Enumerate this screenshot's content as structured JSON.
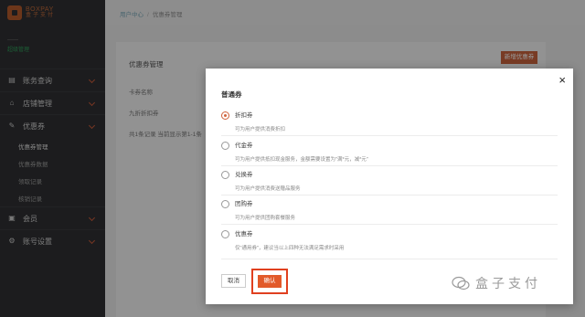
{
  "brand": {
    "en": "BOXPAY",
    "cn": "盒子支付"
  },
  "user": {
    "line1": "——",
    "role": "超级管理"
  },
  "sidebar": {
    "items": [
      {
        "label": "账务查询",
        "icon": "ledger-icon"
      },
      {
        "label": "店铺管理",
        "icon": "store-icon"
      },
      {
        "label": "优惠券",
        "icon": "coupon-icon"
      }
    ],
    "sub_items": [
      {
        "label": "优惠券管理"
      },
      {
        "label": "优惠券数据"
      },
      {
        "label": "领取记录"
      },
      {
        "label": "核销记录"
      }
    ],
    "items_after": [
      {
        "label": "会员",
        "icon": "member-icon"
      },
      {
        "label": "账号设置",
        "icon": "account-icon"
      }
    ]
  },
  "breadcrumb": {
    "home": "用户中心",
    "separator": "/",
    "current": "优惠券管理"
  },
  "panel": {
    "title": "优惠券管理",
    "new_button": "新增优惠券",
    "label1": "卡券名称",
    "label2": "九折折扣券",
    "label3": "共1条记录  当前显示第1-1条"
  },
  "modal": {
    "close": "×",
    "title": "普通券",
    "options": [
      {
        "label": "折扣券",
        "desc": "可为用户提供消费折扣",
        "checked": true
      },
      {
        "label": "代金券",
        "desc": "可为用户提供抵扣现金服务，金额需要设置为\"满*元，减*元\""
      },
      {
        "label": "兑换券",
        "desc": "可为用户提供消费送赠品服务"
      },
      {
        "label": "团购券",
        "desc": "可为用户提供团购套餐服务"
      },
      {
        "label": "优惠券",
        "desc": "仅\"通用券\"，建议当以上四种无法满足需求时采用"
      }
    ],
    "cancel": "取消",
    "confirm": "确认"
  },
  "watermark": {
    "text": "盒子支付"
  },
  "colors": {
    "accent": "#e25a2a",
    "sidebar": "#2f3032",
    "highlight_border": "#e0401f"
  }
}
